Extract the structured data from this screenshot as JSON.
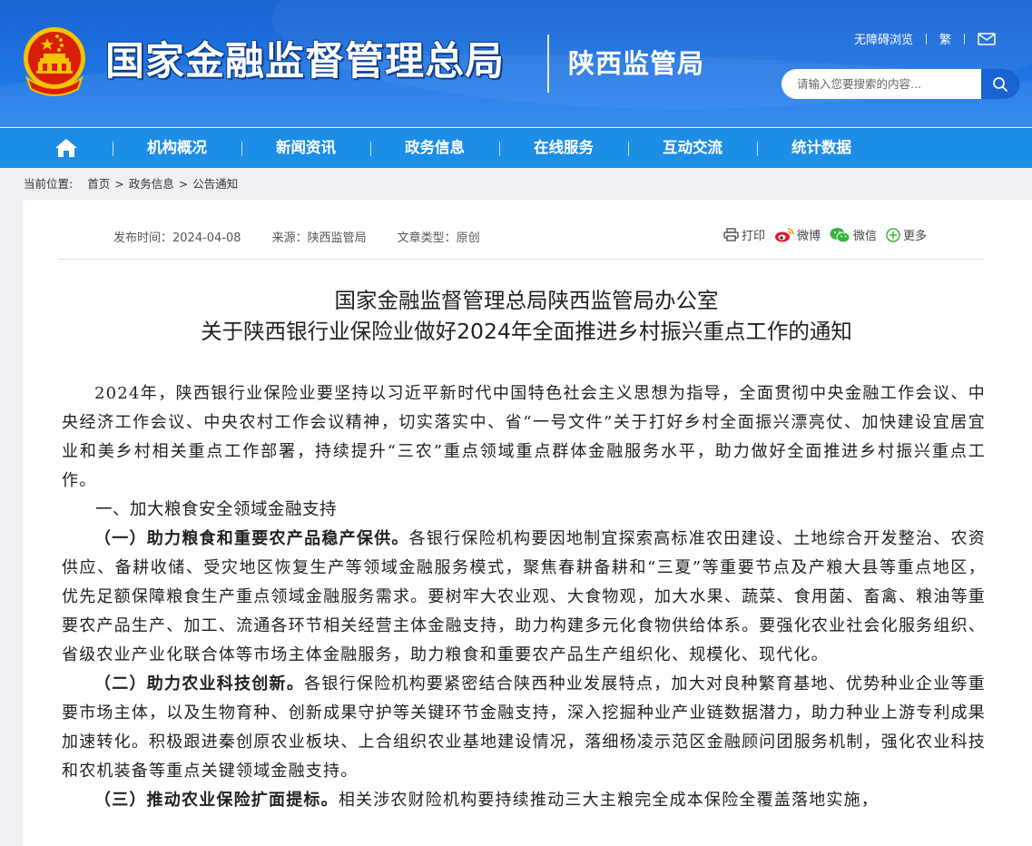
{
  "header": {
    "site_title": "国家金融监督管理总局",
    "sub_title": "陕西监管局",
    "links": {
      "accessibility": "无障碍浏览",
      "traditional": "繁"
    },
    "search_placeholder": "请输入您要搜索的内容...",
    "colors": {
      "header_blue": "#1a63d3",
      "nav_blue": "#1d8ee6",
      "emblem_red": "#d81e06",
      "emblem_gold": "#f5c400"
    }
  },
  "nav": {
    "items": [
      "机构概况",
      "新闻资讯",
      "政务信息",
      "在线服务",
      "互动交流",
      "统计数据"
    ]
  },
  "breadcrumb": {
    "label": "当前位置:",
    "items": [
      "首页",
      "政务信息",
      "公告通知"
    ]
  },
  "article": {
    "meta": {
      "publish_time": "发布时间：2024-04-08",
      "source": "来源：陕西监管局",
      "type": "文章类型：原创"
    },
    "share": {
      "print": "打印",
      "weibo": "微博",
      "wechat": "微信",
      "more": "更多"
    },
    "title_line1": "国家金融监督管理总局陕西监管局办公室",
    "title_line2": "关于陕西银行业保险业做好2024年全面推进乡村振兴重点工作的通知",
    "intro": "2024年，陕西银行业保险业要坚持以习近平新时代中国特色社会主义思想为指导，全面贯彻中央金融工作会议、中央经济工作会议、中央农村工作会议精神，切实落实中、省“一号文件”关于打好乡村全面振兴漂亮仗、加快建设宜居宜业和美乡村相关重点工作部署，持续提升“三农”重点领域重点群体金融服务水平，助力做好全面推进乡村振兴重点工作。",
    "section1": "一、加大粮食安全领域金融支持",
    "p1_bold": "（一）助力粮食和重要农产品稳产保供。",
    "p1_text": "各银行保险机构要因地制宜探索高标准农田建设、土地综合开发整治、农资供应、备耕收储、受灾地区恢复生产等领域金融服务模式，聚焦春耕备耕和“三夏”等重要节点及产粮大县等重点地区，优先足额保障粮食生产重点领域金融服务需求。要树牢大农业观、大食物观，加大水果、蔬菜、食用菌、畜禽、粮油等重要农产品生产、加工、流通各环节相关经营主体金融支持，助力构建多元化食物供给体系。要强化农业社会化服务组织、省级农业产业化联合体等市场主体金融服务，助力粮食和重要农产品生产组织化、规模化、现代化。",
    "p2_bold": "（二）助力农业科技创新。",
    "p2_text": "各银行保险机构要紧密结合陕西种业发展特点，加大对良种繁育基地、优势种业企业等重要市场主体，以及生物育种、创新成果守护等关键环节金融支持，深入挖掘种业产业链数据潜力，助力种业上游专利成果加速转化。积极跟进秦创原农业板块、上合组织农业基地建设情况，落细杨凌示范区金融顾问团服务机制，强化农业科技和农机装备等重点关键领域金融支持。",
    "p3_bold": "（三）推动农业保险扩面提标。",
    "p3_text": "相关涉农财险机构要持续推动三大主粮完全成本保险全覆盖落地实施，"
  }
}
